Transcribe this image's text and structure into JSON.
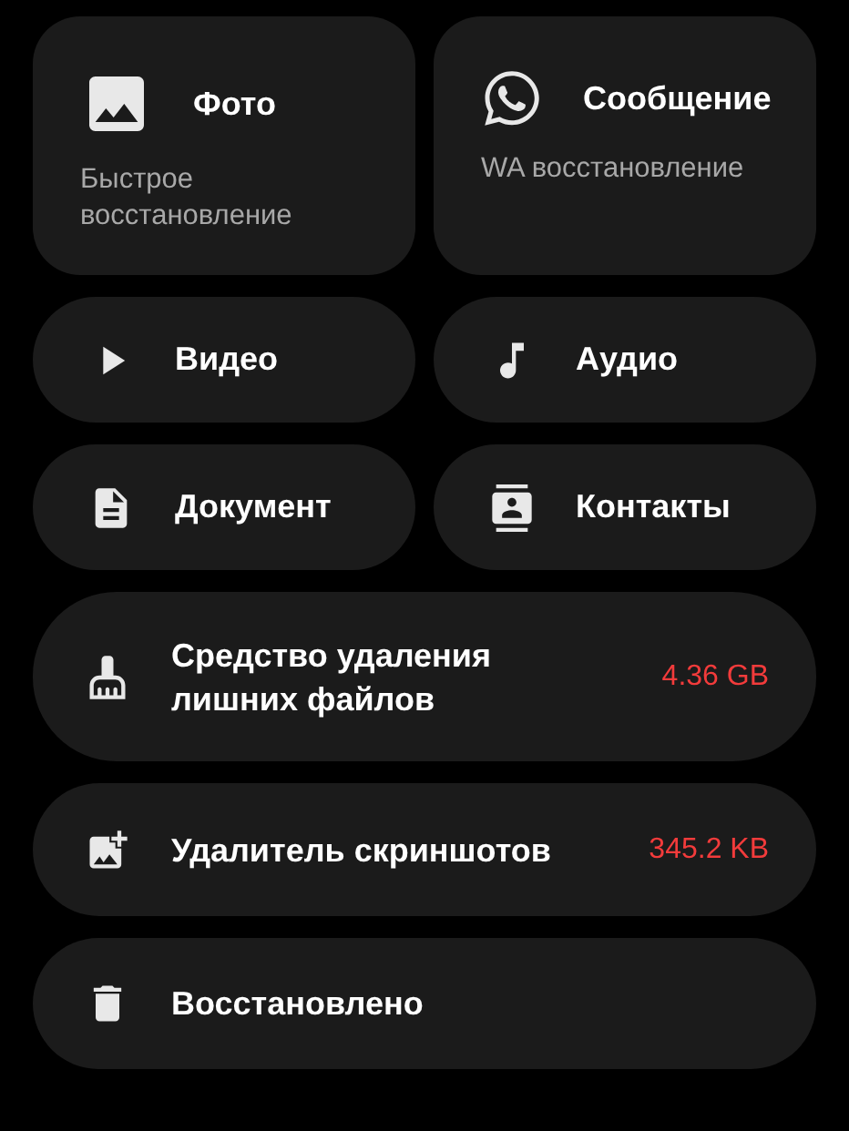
{
  "tiles": [
    {
      "title": "Фото",
      "subtitle": "Быстрое восстановление"
    },
    {
      "title": "Сообщение",
      "subtitle": "WA восстановление"
    }
  ],
  "shortcuts": [
    {
      "title": "Видео"
    },
    {
      "title": "Аудио"
    },
    {
      "title": "Документ"
    },
    {
      "title": "Контакты"
    }
  ],
  "tools": [
    {
      "title": "Средство удаления лишних файлов",
      "size": "4.36 GB"
    },
    {
      "title": "Удалитель скриншотов",
      "size": "345.2 KB"
    },
    {
      "title": "Восстановлено"
    }
  ]
}
